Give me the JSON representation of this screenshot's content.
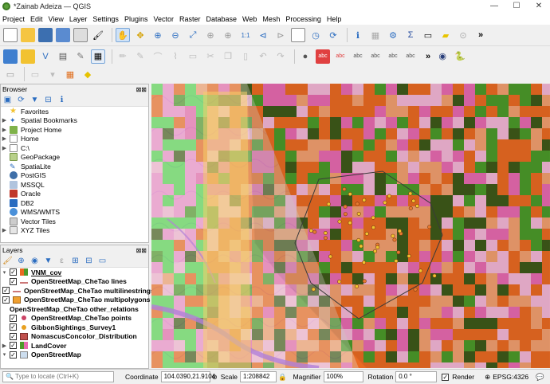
{
  "window": {
    "title": "*Zainab Adeiza — QGIS"
  },
  "menu": [
    "Project",
    "Edit",
    "View",
    "Layer",
    "Settings",
    "Plugins",
    "Vector",
    "Raster",
    "Database",
    "Web",
    "Mesh",
    "Processing",
    "Help"
  ],
  "toolbar_icons": [
    "new-project-icon",
    "open-project-icon",
    "save-project-icon",
    "save-as-icon",
    "print-layout-icon",
    "style-manager-icon",
    "pan-icon",
    "pan-to-selection-icon",
    "zoom-in-icon",
    "zoom-out-icon",
    "zoom-full-icon",
    "zoom-selection-icon",
    "zoom-layer-icon",
    "zoom-native-icon",
    "zoom-last-icon",
    "zoom-next-icon",
    "new-map-view-icon",
    "temporal-icon",
    "refresh-icon",
    "identify-icon",
    "attribute-table-icon",
    "settings-icon",
    "sum-icon",
    "measure-icon",
    "annotation-icon",
    "locate-icon"
  ],
  "browser": {
    "title": "Browser",
    "items": [
      "Favorites",
      "Spatial Bookmarks",
      "Project Home",
      "Home",
      "C:\\",
      "GeoPackage",
      "SpatiaLite",
      "PostGIS",
      "MSSQL",
      "Oracle",
      "DB2",
      "WMS/WMTS",
      "Vector Tiles",
      "XYZ Tiles"
    ]
  },
  "layers": {
    "title": "Layers",
    "items": [
      "VNM_cov",
      "OpenStreetMap_CheTao lines",
      "OpenStreetMap_CheTao multilinestrings",
      "OpenStreetMap_CheTao multipolygons",
      "OpenStreetMap_CheTao other_relations",
      "OpenStreetMap_CheTao points",
      "GibbonSightings_Survey1",
      "NomascusConcolor_Distribution",
      "LandCover",
      "OpenStreetMap"
    ]
  },
  "status": {
    "locate_placeholder": "Type to locate (Ctrl+K)",
    "coordinate_label": "Coordinate",
    "coordinate": "104.0390,21.9104",
    "scale_label": "Scale",
    "scale": "1:208842",
    "magnifier_label": "Magnifier",
    "magnifier": "100%",
    "rotation_label": "Rotation",
    "rotation": "0.0 °",
    "render_label": "Render",
    "crs": "EPSG:4326"
  },
  "colors": {
    "accent": "#ffd24d",
    "landcover_orange": "#ea6a22",
    "landcover_green": "#4c9a2a",
    "landcover_pink": "#e86ab0",
    "landcover_olive": "#3f5a1a",
    "osm_base": "#e8e0d8"
  }
}
